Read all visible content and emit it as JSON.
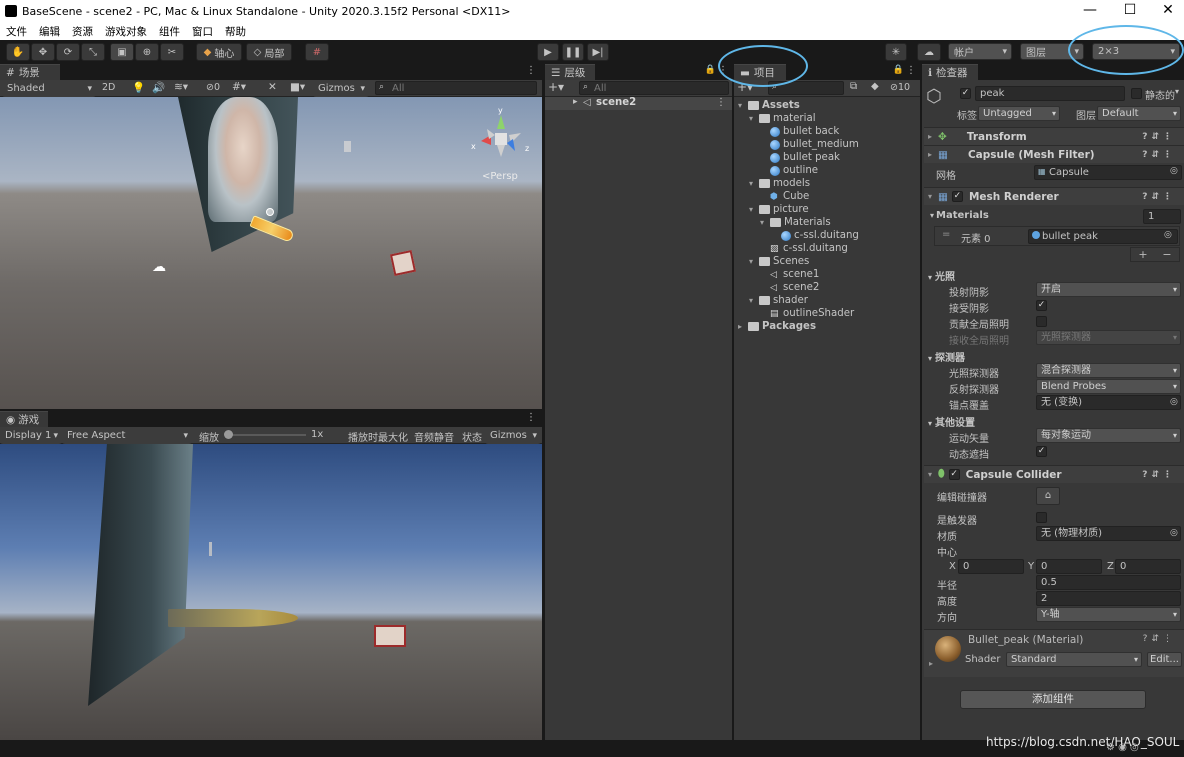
{
  "window": {
    "title": "BaseScene - scene2 - PC, Mac & Linux Standalone - Unity 2020.3.15f2 Personal <DX11>",
    "minimize": "—",
    "maximize": "☐",
    "close": "✕"
  },
  "menu": [
    "文件",
    "编辑",
    "资源",
    "游戏对象",
    "组件",
    "窗口",
    "帮助"
  ],
  "toolbar": {
    "pivot": "轴心",
    "local": "局部",
    "account": "帐户",
    "layers": "图层",
    "layout": "2×3"
  },
  "scene": {
    "tab": "场景",
    "shading": "Shaded",
    "mode2d": "2D",
    "hidden_count": "0",
    "gizmos": "Gizmos",
    "search_placeholder": "All",
    "persp": "<Persp"
  },
  "game": {
    "tab": "游戏",
    "display": "Display 1",
    "aspect": "Free Aspect",
    "scale_label": "缩放",
    "scale_value": "1x",
    "maximize": "播放时最大化",
    "mute": "音频静音",
    "stats": "状态",
    "gizmos": "Gizmos"
  },
  "hierarchy": {
    "tab": "层级",
    "search_placeholder": "All",
    "scene_name": "scene2"
  },
  "project": {
    "tab": "项目",
    "hidden_count": "10",
    "tree": [
      {
        "label": "Assets",
        "level": 0,
        "type": "folder",
        "bold": true
      },
      {
        "label": "material",
        "level": 1,
        "type": "folder"
      },
      {
        "label": "bullet back",
        "level": 2,
        "type": "mat"
      },
      {
        "label": "bullet_medium",
        "level": 2,
        "type": "mat"
      },
      {
        "label": "bullet peak",
        "level": 2,
        "type": "mat"
      },
      {
        "label": "outline",
        "level": 2,
        "type": "mat"
      },
      {
        "label": "models",
        "level": 1,
        "type": "folder"
      },
      {
        "label": "Cube",
        "level": 2,
        "type": "cube"
      },
      {
        "label": "picture",
        "level": 1,
        "type": "folder"
      },
      {
        "label": "Materials",
        "level": 2,
        "type": "folder"
      },
      {
        "label": "c-ssl.duitang",
        "level": 3,
        "type": "mat"
      },
      {
        "label": "c-ssl.duitang",
        "level": 2,
        "type": "img"
      },
      {
        "label": "Scenes",
        "level": 1,
        "type": "folder"
      },
      {
        "label": "scene1",
        "level": 2,
        "type": "unity"
      },
      {
        "label": "scene2",
        "level": 2,
        "type": "unity"
      },
      {
        "label": "shader",
        "level": 1,
        "type": "folder"
      },
      {
        "label": "outlineShader",
        "level": 2,
        "type": "shader"
      },
      {
        "label": "Packages",
        "level": 0,
        "type": "folder",
        "bold": true
      }
    ]
  },
  "inspector": {
    "tab": "检查器",
    "name": "peak",
    "static": "静态的",
    "tag_label": "标签",
    "tag": "Untagged",
    "layer_label": "图层",
    "layer": "Default",
    "transform": "Transform",
    "mesh_filter": "Capsule (Mesh Filter)",
    "mesh_label": "网格",
    "mesh_value": "Capsule",
    "mesh_renderer": "Mesh Renderer",
    "materials_label": "Materials",
    "materials_count": "1",
    "element0_label": "元素 0",
    "element0_value": "bullet peak",
    "lighting": "光照",
    "cast_shadows_label": "投射阴影",
    "cast_shadows": "开启",
    "receive_shadows_label": "接受阴影",
    "contribute_gi_label": "贡献全局照明",
    "receive_gi_label": "接收全局照明",
    "receive_gi": "光照探测器",
    "probes": "探测器",
    "light_probes_label": "光照探测器",
    "light_probes": "混合探测器",
    "reflection_probes_label": "反射探测器",
    "reflection_probes": "Blend Probes",
    "anchor_label": "锚点覆盖",
    "anchor": "无 (变换)",
    "additional": "其他设置",
    "motion_label": "运动矢量",
    "motion": "每对象运动",
    "dynamic_occ_label": "动态遮挡",
    "capsule_collider": "Capsule Collider",
    "edit_collider_label": "编辑碰撞器",
    "is_trigger_label": "是触发器",
    "material_label": "材质",
    "material_value": "无 (物理材质)",
    "center_label": "中心",
    "cx_label": "X",
    "cx": "0",
    "cy_label": "Y",
    "cy": "0",
    "cz_label": "Z",
    "cz": "0",
    "radius_label": "半径",
    "radius": "0.5",
    "height_label": "高度",
    "height": "2",
    "direction_label": "方向",
    "direction": "Y-轴",
    "mat_title": "Bullet_peak (Material)",
    "shader_label": "Shader",
    "shader": "Standard",
    "edit": "Edit...",
    "add_component": "添加组件"
  },
  "watermark": "https://blog.csdn.net/HAO_SOUL",
  "colors": {
    "highlight_circle": "#5fb7e8",
    "panel": "#383838",
    "toolbar": "#191919"
  }
}
